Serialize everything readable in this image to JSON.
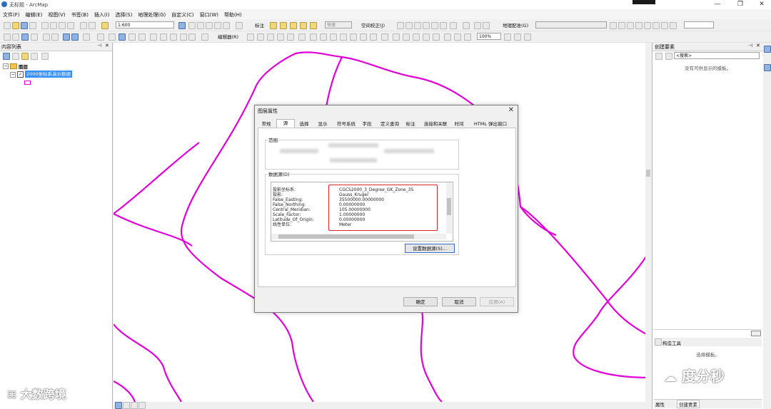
{
  "window": {
    "title": "无标题 - ArcMap",
    "min": "—",
    "max": "❐",
    "close": "✕"
  },
  "menu": [
    "文件(F)",
    "编辑(E)",
    "视图(V)",
    "书签(B)",
    "插入(I)",
    "选择(S)",
    "地理处理(G)",
    "自定义(C)",
    "窗口(W)",
    "帮助(H)"
  ],
  "toolbar": {
    "scale": "1:600",
    "label_tool": "标注",
    "label_fast": "快速",
    "spatial_adjust": "空间校正(J)",
    "georef": "地理配准(G)",
    "editor": "编辑器(R)",
    "zoom": "100%"
  },
  "toc": {
    "title": "内容列表",
    "layers_group": "图层",
    "layer_name": "2000坐标系演示数据",
    "colors": {
      "symbol": "#e000e0"
    }
  },
  "create_features": {
    "title": "创建要素",
    "search_placeholder": "<搜索>",
    "empty_msg": "没有可供显示的模板。",
    "construct_title": "构造工具",
    "construct_msg": "选择模板。",
    "tab_props": "属性",
    "tab_create": "创建要素"
  },
  "dialog": {
    "title": "图层属性",
    "tabs": [
      "常规",
      "源",
      "选择",
      "显示",
      "符号系统",
      "字段",
      "定义查询",
      "标注",
      "连接和关联",
      "时间",
      "HTML 弹出窗口"
    ],
    "active_tab": 1,
    "extent_label": "范围",
    "datasource_label": "数据源(D)",
    "spatial_ref": [
      {
        "key": "投影坐标系:",
        "value": "CGCS2000_3_Degree_GK_Zone_35"
      },
      {
        "key": "投影:",
        "value": "Gauss_Kruger"
      },
      {
        "key": "False_Easting:",
        "value": "35500000.00000000"
      },
      {
        "key": "False_Northing:",
        "value": "0.00000000"
      },
      {
        "key": "Central_Meridian:",
        "value": "105.00000000"
      },
      {
        "key": "Scale_Factor:",
        "value": "1.00000000"
      },
      {
        "key": "Latitude_Of_Origin:",
        "value": "0.00000000"
      },
      {
        "key": "线性单位:",
        "value": "Meter"
      }
    ],
    "set_source_btn": "设置数据源(S)...",
    "ok": "确定",
    "cancel": "取消",
    "apply": "应用(A)",
    "colors": {
      "highlight": "#e0222a"
    }
  },
  "watermarks": {
    "left": "大数跨境",
    "right": "度分秒"
  },
  "colors": {
    "map_lines": "#e000d8",
    "selection": "#3390ff"
  }
}
